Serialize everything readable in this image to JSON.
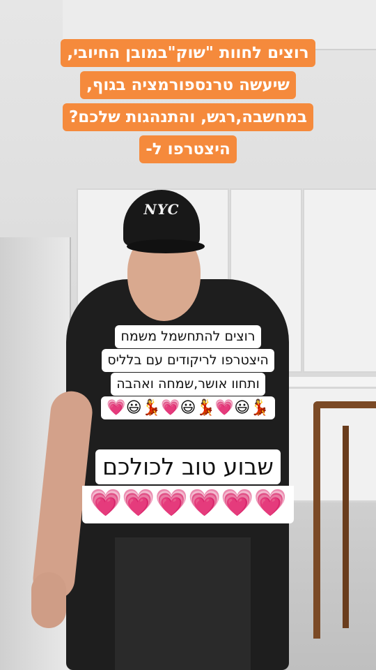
{
  "orange_caption": [
    "רוצים לחוות \"שוק\"במובן החיובי,",
    "שיעשה טרנספורמציה בגוף,",
    "במחשבה,רגש, והתנהגות שלכם?",
    "היצטרפו ל-"
  ],
  "white_caption": [
    "רוצים להתחשמל משמח",
    "היצטרפו לריקודים עם בלליס",
    "ותחוו אושר,שמחה ואהבה",
    "💃😃💗💃😃💗💃😃💗"
  ],
  "greeting": "שבוע טוב לכולכם",
  "greeting_hearts": "💗💗💗💗💗💗",
  "cap_text": "NYC",
  "colors": {
    "orange": "#f58a3c",
    "white_box": "#ffffff",
    "heart": "#e4396a"
  }
}
